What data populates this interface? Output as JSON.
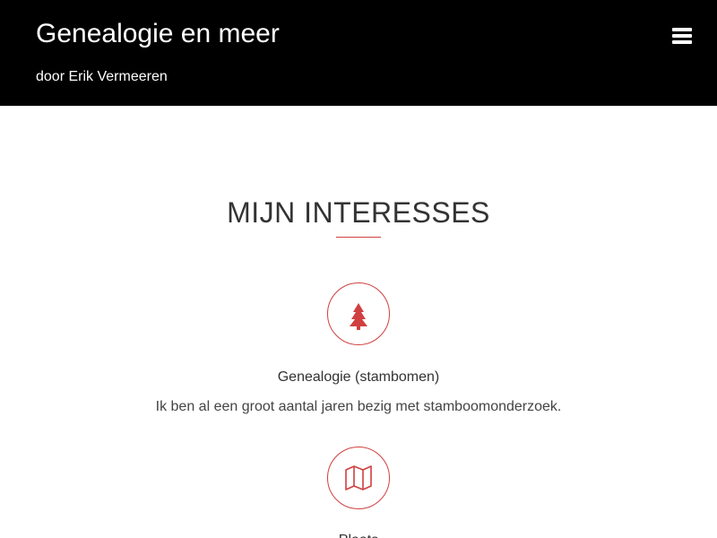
{
  "header": {
    "title": "Genealogie en meer",
    "tagline": "door Erik Vermeeren",
    "menu_icon": "hamburger-menu-icon"
  },
  "section": {
    "title": "MIJN INTERESSES"
  },
  "interests": [
    {
      "icon": "tree-icon",
      "title": "Genealogie (stambomen)",
      "description": "Ik ben al een groot aantal jaren bezig met stamboomonderzoek."
    },
    {
      "icon": "map-icon",
      "title": "Plaats"
    }
  ],
  "colors": {
    "header_bg": "#000000",
    "accent": "#d04040",
    "text": "#333333"
  }
}
